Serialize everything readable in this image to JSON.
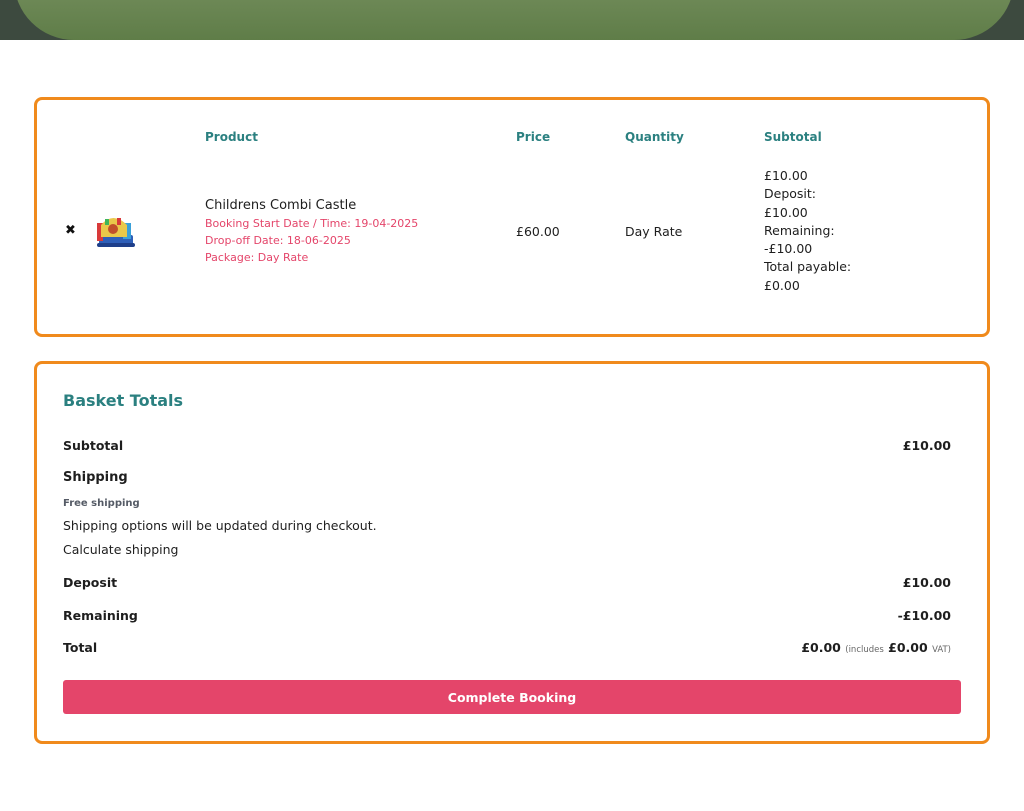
{
  "cart": {
    "headers": {
      "product": "Product",
      "price": "Price",
      "quantity": "Quantity",
      "subtotal": "Subtotal"
    },
    "item": {
      "remove_symbol": "✖",
      "name": "Childrens Combi Castle",
      "booking_start": "Booking Start Date / Time: 19-04-2025",
      "dropoff": "Drop-off Date: 18-06-2025",
      "package": "Package: Day Rate",
      "price": "£60.00",
      "quantity": "Day Rate",
      "subtotal_lines": [
        "£10.00",
        "Deposit:",
        "£10.00",
        "Remaining:",
        "-£10.00",
        "Total payable:",
        "£0.00"
      ]
    }
  },
  "totals": {
    "title": "Basket Totals",
    "subtotal_label": "Subtotal",
    "subtotal_value": "£10.00",
    "shipping_label": "Shipping",
    "free_shipping": "Free shipping",
    "shipping_note": "Shipping options will be updated during checkout.",
    "calculate_shipping": "Calculate shipping",
    "deposit_label": "Deposit",
    "deposit_value": "£10.00",
    "remaining_label": "Remaining",
    "remaining_value": "-£10.00",
    "total_label": "Total",
    "total_value": "£0.00",
    "includes_text": "(includes",
    "vat_amount": "£0.00",
    "vat_text": "VAT)",
    "button_label": "Complete Booking"
  },
  "colors": {
    "accent_teal": "#2b8080",
    "accent_pink": "#e4456a",
    "panel_border": "#f08a1c"
  }
}
